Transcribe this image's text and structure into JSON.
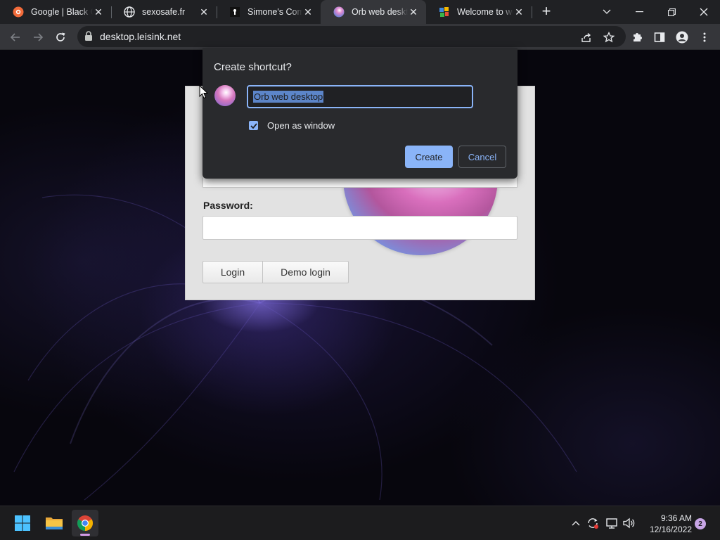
{
  "browser": {
    "tabs": [
      {
        "title": "Google | Black Cl",
        "favicon": "brave-like-icon"
      },
      {
        "title": "sexosafe.fr",
        "favicon": "globe-icon"
      },
      {
        "title": "Simone's Comp",
        "favicon": "keyhole-icon"
      },
      {
        "title": "Orb web deskto",
        "favicon": "orb-icon",
        "active": true
      },
      {
        "title": "Welcome to wel",
        "favicon": "colorful-logo-icon"
      }
    ],
    "new_tab_label": "+",
    "url": "desktop.leisink.net"
  },
  "login": {
    "password_label": "Password:",
    "login_button": "Login",
    "demo_button": "Demo login"
  },
  "dialog": {
    "title": "Create shortcut?",
    "name_value": "Orb web desktop",
    "open_as_window_label": "Open as window",
    "open_as_window_checked": true,
    "create_button": "Create",
    "cancel_button": "Cancel"
  },
  "taskbar": {
    "time": "9:36 AM",
    "date": "12/16/2022",
    "notification_count": "2"
  },
  "colors": {
    "accent": "#8ab4f8",
    "chrome_dark": "#202124",
    "toolbar": "#35363a"
  }
}
